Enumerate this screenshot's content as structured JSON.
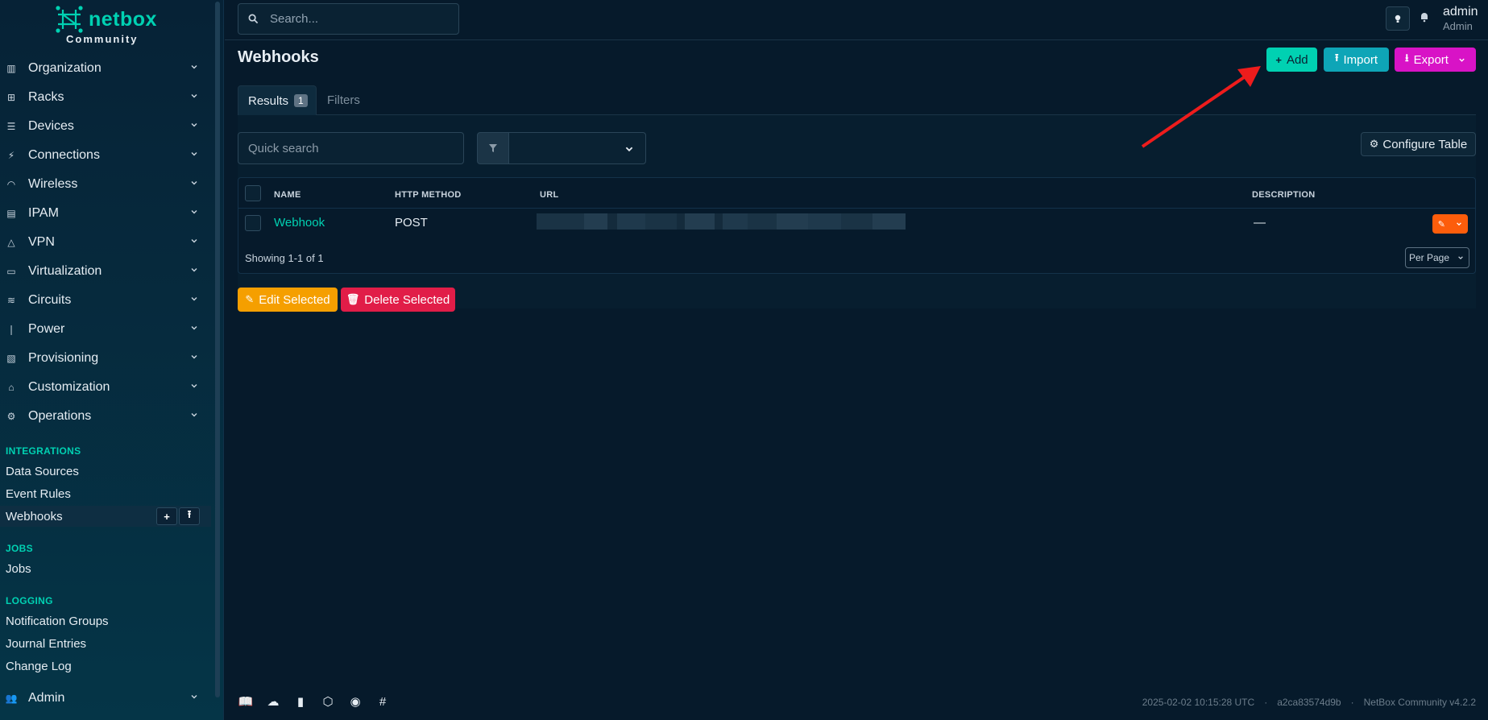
{
  "brand": {
    "name": "netbox",
    "subtitle": "Community"
  },
  "sidebar": {
    "menus": [
      {
        "label": "Organization",
        "icon": "organization-icon"
      },
      {
        "label": "Racks",
        "icon": "rack-icon"
      },
      {
        "label": "Devices",
        "icon": "server-icon"
      },
      {
        "label": "Connections",
        "icon": "cable-icon"
      },
      {
        "label": "Wireless",
        "icon": "wifi-icon"
      },
      {
        "label": "IPAM",
        "icon": "counter-icon"
      },
      {
        "label": "VPN",
        "icon": "vpn-icon"
      },
      {
        "label": "Virtualization",
        "icon": "monitor-icon"
      },
      {
        "label": "Circuits",
        "icon": "transit-icon"
      },
      {
        "label": "Power",
        "icon": "flash-icon"
      },
      {
        "label": "Provisioning",
        "icon": "file-icon"
      },
      {
        "label": "Customization",
        "icon": "toolbox-icon"
      },
      {
        "label": "Operations",
        "icon": "cogs-icon"
      }
    ],
    "integrations": {
      "heading": "INTEGRATIONS",
      "items": [
        "Data Sources",
        "Event Rules",
        "Webhooks"
      ]
    },
    "jobs": {
      "heading": "JOBS",
      "items": [
        "Jobs"
      ]
    },
    "logging": {
      "heading": "LOGGING",
      "items": [
        "Notification Groups",
        "Journal Entries",
        "Change Log"
      ]
    },
    "admin": {
      "label": "Admin"
    },
    "active_item": "Webhooks"
  },
  "topbar": {
    "search_placeholder": "Search...",
    "user_name": "admin",
    "user_role": "Admin"
  },
  "page": {
    "title": "Webhooks",
    "buttons": {
      "add": "Add",
      "import": "Import",
      "export": "Export"
    },
    "tabs": {
      "results": "Results",
      "results_count": "1",
      "filters": "Filters"
    },
    "quick_search_placeholder": "Quick search",
    "configure_table": "Configure Table",
    "table": {
      "columns": [
        "NAME",
        "HTTP METHOD",
        "URL",
        "DESCRIPTION"
      ],
      "rows": [
        {
          "name": "Webhook",
          "http_method": "POST",
          "description": "—"
        }
      ],
      "showing": "Showing 1-1 of 1",
      "per_page": "Per Page"
    },
    "bulk": {
      "edit": "Edit Selected",
      "delete": "Delete Selected"
    }
  },
  "footer": {
    "timestamp": "2025-02-02 10:15:28 UTC",
    "commit": "a2ca83574d9b",
    "version": "NetBox Community v4.2.2"
  },
  "colors": {
    "accent": "#00d1b2",
    "import": "#0ea5b7",
    "export": "#d813c6",
    "edit": "#f59f00",
    "delete": "#e11d48",
    "row_edit": "#fd5d0b",
    "annotation_arrow": "#ee1c1c"
  }
}
